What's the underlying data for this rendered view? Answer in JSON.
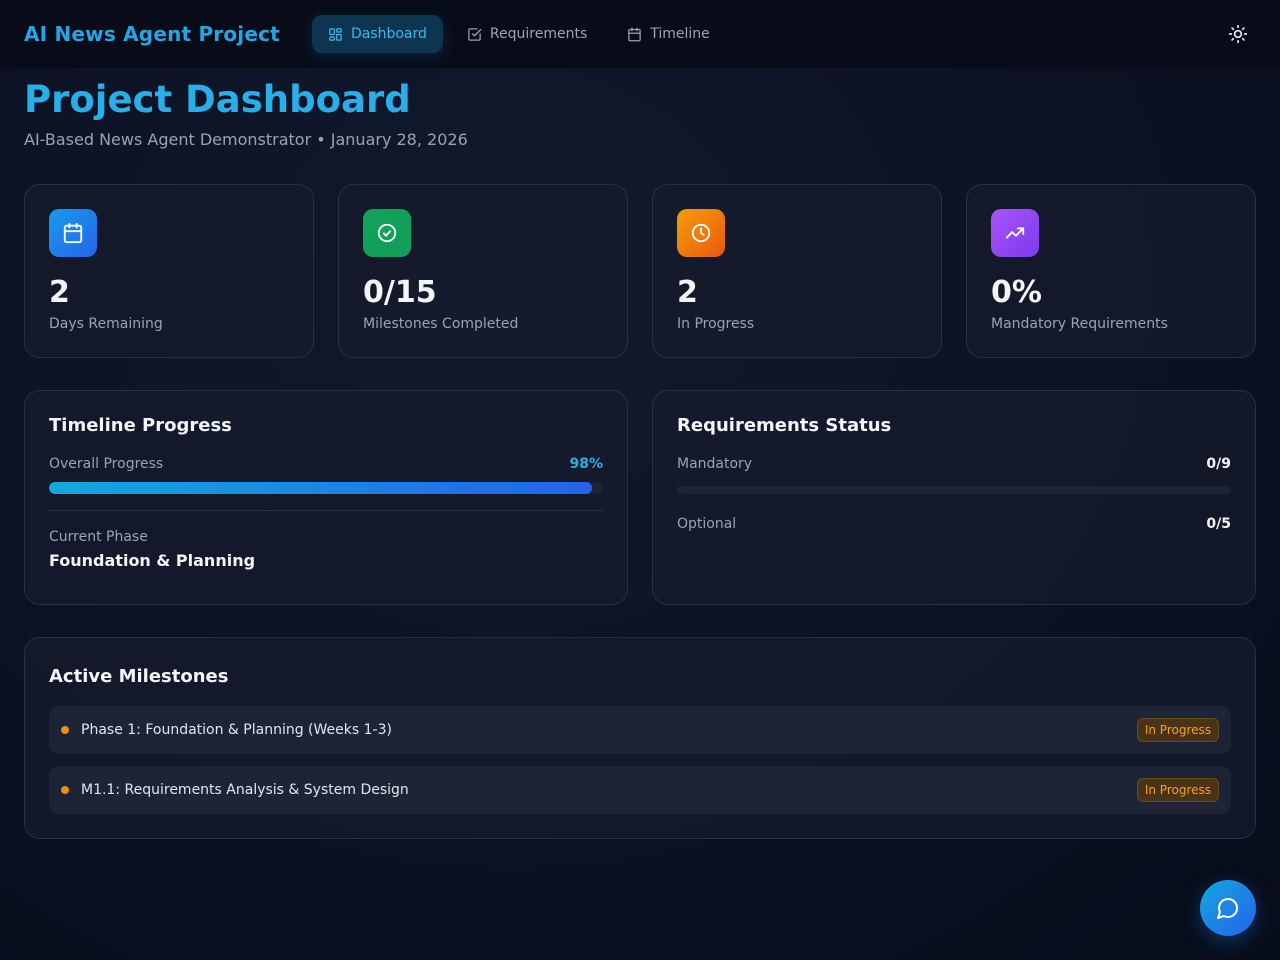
{
  "app": {
    "brand": "AI News Agent Project",
    "nav": [
      {
        "label": "Dashboard",
        "icon": "dashboard-icon",
        "active": true
      },
      {
        "label": "Requirements",
        "icon": "checkbox-icon",
        "active": false
      },
      {
        "label": "Timeline",
        "icon": "calendar-icon",
        "active": false
      }
    ],
    "theme_toggle_icon": "sun-icon"
  },
  "header": {
    "title": "Project Dashboard",
    "subtitle": "AI-Based News Agent Demonstrator • January 28, 2026"
  },
  "stats": [
    {
      "value": "2",
      "label": "Days Remaining",
      "icon": "calendar-icon",
      "color": "#2563eb"
    },
    {
      "value": "0/15",
      "label": "Milestones Completed",
      "icon": "check-circle-icon",
      "color": "#16a34a"
    },
    {
      "value": "2",
      "label": "In Progress",
      "icon": "clock-icon",
      "color": "#f97316"
    },
    {
      "value": "0%",
      "label": "Mandatory Requirements",
      "icon": "trending-up-icon",
      "color": "#9333ea"
    }
  ],
  "timeline": {
    "title": "Timeline Progress",
    "progress_label": "Overall Progress",
    "progress_text": "98%",
    "progress_value": 0.98,
    "phase_label": "Current Phase",
    "phase_value": "Foundation & Planning"
  },
  "requirements": {
    "title": "Requirements Status",
    "mandatory_label": "Mandatory",
    "mandatory_value": "0/9",
    "mandatory_fraction": 0,
    "optional_label": "Optional",
    "optional_value": "0/5"
  },
  "milestones": {
    "title": "Active Milestones",
    "items": [
      {
        "label": "Phase 1: Foundation & Planning (Weeks 1-3)",
        "status": "In Progress"
      },
      {
        "label": "M1.1: Requirements Analysis & System Design",
        "status": "In Progress"
      }
    ]
  },
  "chat": {
    "icon": "chat-bubble-icon"
  }
}
